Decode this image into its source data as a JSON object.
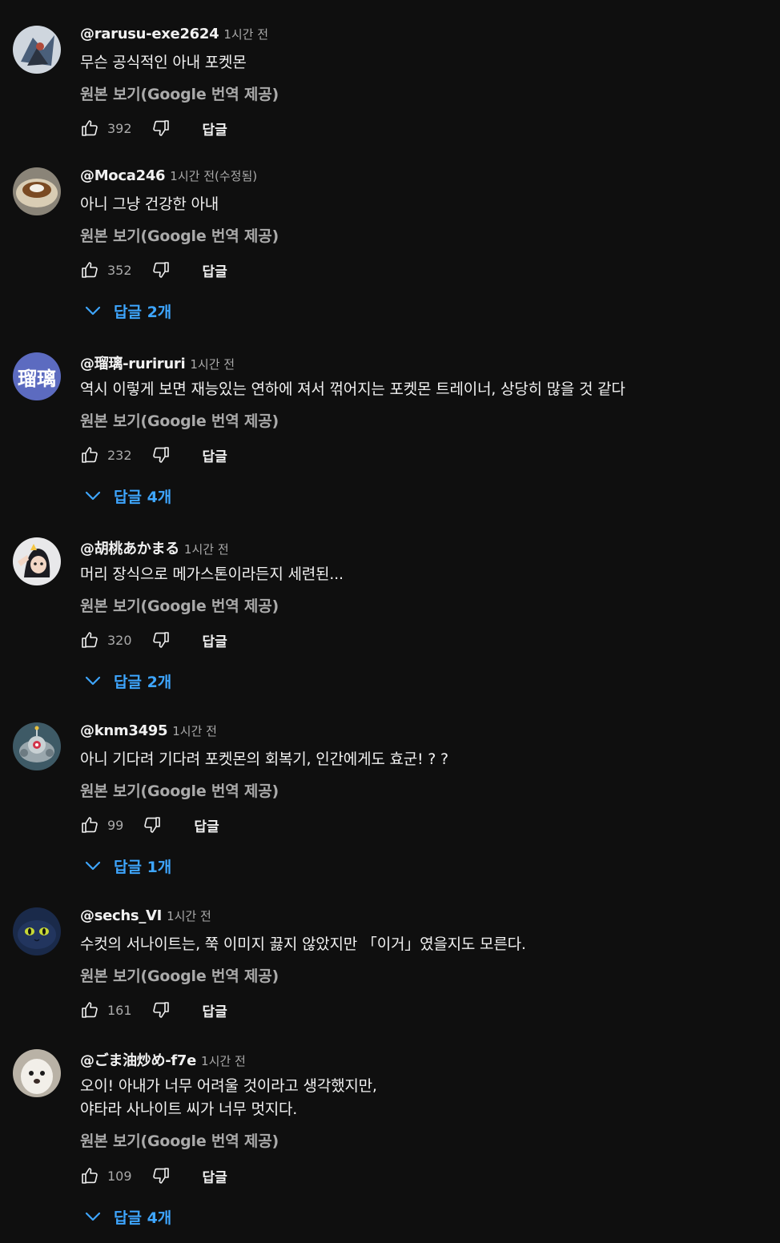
{
  "comments": [
    {
      "author": "@rarusu-exe2624",
      "time": "1시간 전",
      "text1": "무슨 공식적인 아내 포켓몬",
      "text2": "",
      "translate": "원본 보기(Google 번역 제공)",
      "likes": "392",
      "reply": "답글",
      "replies": ""
    },
    {
      "author": "@Moca246",
      "time": "1시간 전(수정됨)",
      "text1": "아니 그냥 건강한 아내",
      "text2": "",
      "translate": "원본 보기(Google 번역 제공)",
      "likes": "352",
      "reply": "답글",
      "replies": "답글 2개"
    },
    {
      "author": "@瑠璃-ruriruri",
      "time": "1시간 전",
      "text1": "역시 이렇게 보면 재능있는 연하에 져서 꺾어지는 포켓몬 트레이너, 상당히 많을 것 같다",
      "text2": "",
      "translate": "원본 보기(Google 번역 제공)",
      "likes": "232",
      "reply": "답글",
      "replies": "답글 4개",
      "avatar_text": "瑠璃"
    },
    {
      "author": "@胡桃あかまる",
      "time": "1시간 전",
      "text1": "머리 장식으로 메가스톤이라든지 세련된...",
      "text2": "",
      "translate": "원본 보기(Google 번역 제공)",
      "likes": "320",
      "reply": "답글",
      "replies": "답글 2개"
    },
    {
      "author": "@knm3495",
      "time": "1시간 전",
      "text1": "아니 기다려 기다려 포켓몬의 회복기, 인간에게도 효군! ? ?",
      "text2": "",
      "translate": "원본 보기(Google 번역 제공)",
      "likes": "99",
      "reply": "답글",
      "replies": "답글 1개"
    },
    {
      "author": "@sechs_VI",
      "time": "1시간 전",
      "text1": "수컷의 서나이트는, 쭉 이미지 끓지 않았지만 「이거」였을지도 모른다.",
      "text2": "",
      "translate": "원본 보기(Google 번역 제공)",
      "likes": "161",
      "reply": "답글",
      "replies": ""
    },
    {
      "author": "@ごま油炒め-f7e",
      "time": "1시간 전",
      "text1": "오이! 아내가 너무 어려울 것이라고 생각했지만,",
      "text2": "야타라 사나이트 씨가 너무 멋지다.",
      "translate": "원본 보기(Google 번역 제공)",
      "likes": "109",
      "reply": "답글",
      "replies": "답글 4개"
    }
  ],
  "colors": {
    "background": "#0f0f0f",
    "accent": "#3ea6ff",
    "secondary_text": "#aaaaaa"
  },
  "icons": {
    "like": "thumbs-up-icon",
    "dislike": "thumbs-down-icon",
    "expand": "chevron-down-icon"
  }
}
